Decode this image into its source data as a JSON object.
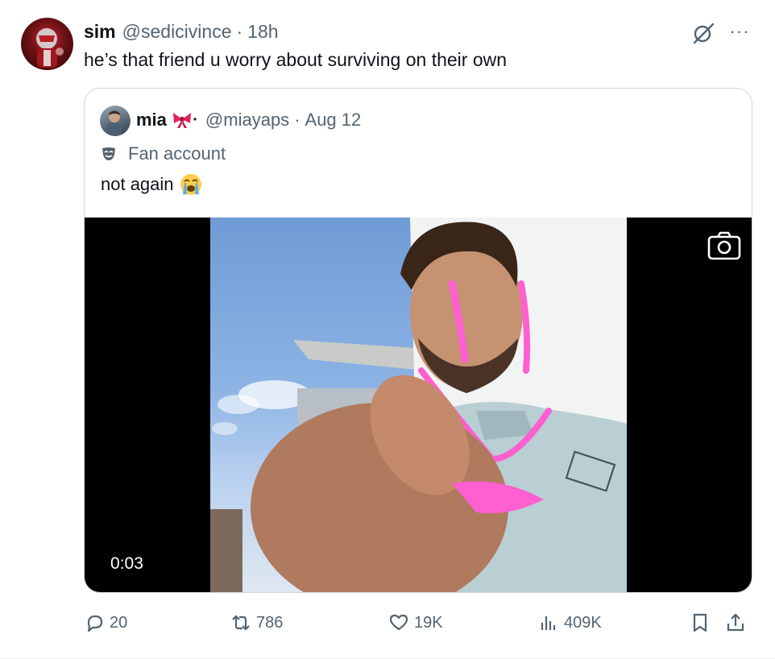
{
  "tweet": {
    "author_name": "sim",
    "author_handle": "@sedicivince",
    "separator": "·",
    "time": "18h",
    "text": "he’s that friend u worry about surviving on their own",
    "more_label": "···"
  },
  "quote": {
    "author_name": "mia",
    "author_handle": "@miayaps",
    "separator": "·",
    "date": "Aug 12",
    "label": "Fan account",
    "text": "not again",
    "video_duration": "0:03"
  },
  "actions": {
    "replies": "20",
    "reposts": "786",
    "likes": "19K",
    "views": "409K"
  },
  "icons": {
    "grok": "grok-icon",
    "more": "more-icon",
    "fan_label": "mask-icon",
    "emoji": "loudly-crying-face-emoji",
    "camera": "camera-icon",
    "reply": "reply-icon",
    "repost": "repost-icon",
    "like": "heart-icon",
    "views": "views-icon",
    "bookmark": "bookmark-icon",
    "share": "share-icon"
  },
  "colors": {
    "text": "#0f1419",
    "secondary": "#536471",
    "border": "#cfd9de",
    "ribbon": "#e0245e",
    "marker": "#ff5fcf"
  }
}
